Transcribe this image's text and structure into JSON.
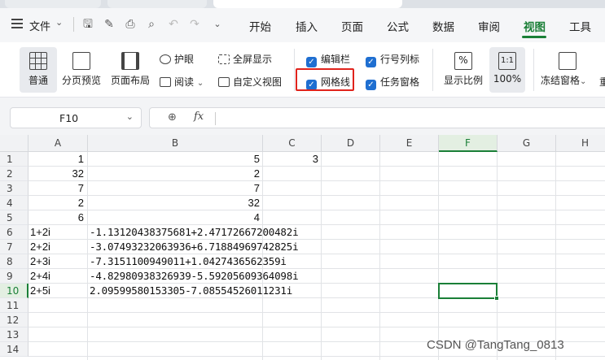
{
  "menubar": {
    "file_label": "文件",
    "menus": [
      "开始",
      "插入",
      "页面",
      "公式",
      "数据",
      "审阅",
      "视图",
      "工具"
    ],
    "active_menu": "视图"
  },
  "ribbon": {
    "normal": "普通",
    "page_break_preview": "分页预览",
    "page_layout": "页面布局",
    "eye_protect": "护眼",
    "reading": "阅读",
    "fullscreen": "全屏显示",
    "custom_view": "自定义视图",
    "chk_formula_bar": "编辑栏",
    "chk_gridlines": "网格线",
    "chk_headings": "行号列标",
    "chk_task_pane": "任务窗格",
    "zoom_ratio": "显示比例",
    "zoom_100": "100%",
    "zoom_100_icon_text": "1:1",
    "freeze_panes": "冻结窗格",
    "freeze_next": "重"
  },
  "formula_bar": {
    "name_box": "F10",
    "fx": "fx",
    "content": ""
  },
  "grid": {
    "columns": [
      "A",
      "B",
      "C",
      "D",
      "E",
      "F",
      "G",
      "H"
    ],
    "active_column": "F",
    "rows": [
      "1",
      "2",
      "3",
      "4",
      "5",
      "6",
      "7",
      "8",
      "9",
      "10",
      "11",
      "12",
      "13",
      "14"
    ],
    "active_row": "10",
    "colA": [
      "1",
      "32",
      "7",
      "2",
      "6",
      "1+2i",
      "2+2i",
      "2+3i",
      "2+4i",
      "2+5i"
    ],
    "colB": [
      "5",
      "2",
      "7",
      "32",
      "4",
      "-1.13120438375681+2.47172667200482i",
      "-3.07493232063936+6.71884969742825i",
      "-7.3151100949011+1.0427436562359i",
      "-4.82980938326939-5.59205609364098i",
      "2.09599580153305-7.08554526011231i"
    ],
    "colC": [
      "3"
    ]
  },
  "watermark": "CSDN @TangTang_0813",
  "colors": {
    "accent": "#1a7f37",
    "checkbox": "#1f6fd1",
    "highlight": "#e0231c"
  }
}
